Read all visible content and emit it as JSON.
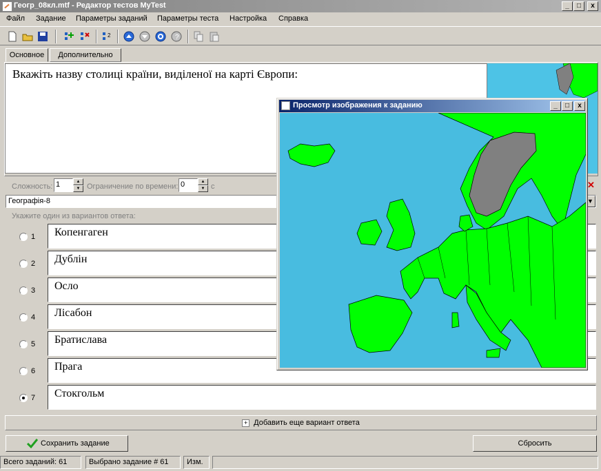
{
  "window": {
    "title": "Геогр_08кл.mtf - Редактор тестов MyTest",
    "controls": {
      "minimize": "_",
      "maximize": "□",
      "close": "x"
    }
  },
  "menu": [
    "Файл",
    "Задание",
    "Параметры заданий",
    "Параметры теста",
    "Настройка",
    "Справка"
  ],
  "toolbar_icons": [
    "new-file-icon",
    "open-folder-icon",
    "save-icon",
    "add-task-icon",
    "delete-task-icon",
    "task-list-icon",
    "move-up-icon",
    "move-down-icon",
    "refresh-icon",
    "info-icon",
    "copy-icon",
    "paste-icon"
  ],
  "tabs": [
    {
      "label": "Основное",
      "active": true
    },
    {
      "label": "Дополнительно",
      "active": false
    }
  ],
  "question": {
    "text": "Вкажіть назву столиці країни, виділеної на карті Європи:"
  },
  "params": {
    "difficulty_label": "Сложность:",
    "difficulty_value": "1",
    "time_limit_label": "Ограничение по времени:",
    "time_limit_value": "0",
    "time_unit": "с"
  },
  "topic": {
    "value": "Географія-8"
  },
  "answers_hint": "Укажите один из вариантов ответа:",
  "answers": [
    {
      "num": "1",
      "text": "Копенгаген",
      "selected": false
    },
    {
      "num": "2",
      "text": "Дублін",
      "selected": false
    },
    {
      "num": "3",
      "text": "Осло",
      "selected": false
    },
    {
      "num": "4",
      "text": "Лісабон",
      "selected": false
    },
    {
      "num": "5",
      "text": "Братислава",
      "selected": false
    },
    {
      "num": "6",
      "text": "Прага",
      "selected": false
    },
    {
      "num": "7",
      "text": "Стокгольм",
      "selected": true
    }
  ],
  "add_answer_label": "Добавить еще вариант ответа",
  "buttons": {
    "save": "Сохранить задание",
    "reset": "Сбросить"
  },
  "status": {
    "total": "Всего заданий: 61",
    "selected": "Выбрано задание # 61",
    "modified": "Изм."
  },
  "image_preview": {
    "title": "Просмотр изображения к заданию",
    "colors": {
      "sea": "#48bce0",
      "land": "#00ff00",
      "highlight": "#808080"
    }
  }
}
